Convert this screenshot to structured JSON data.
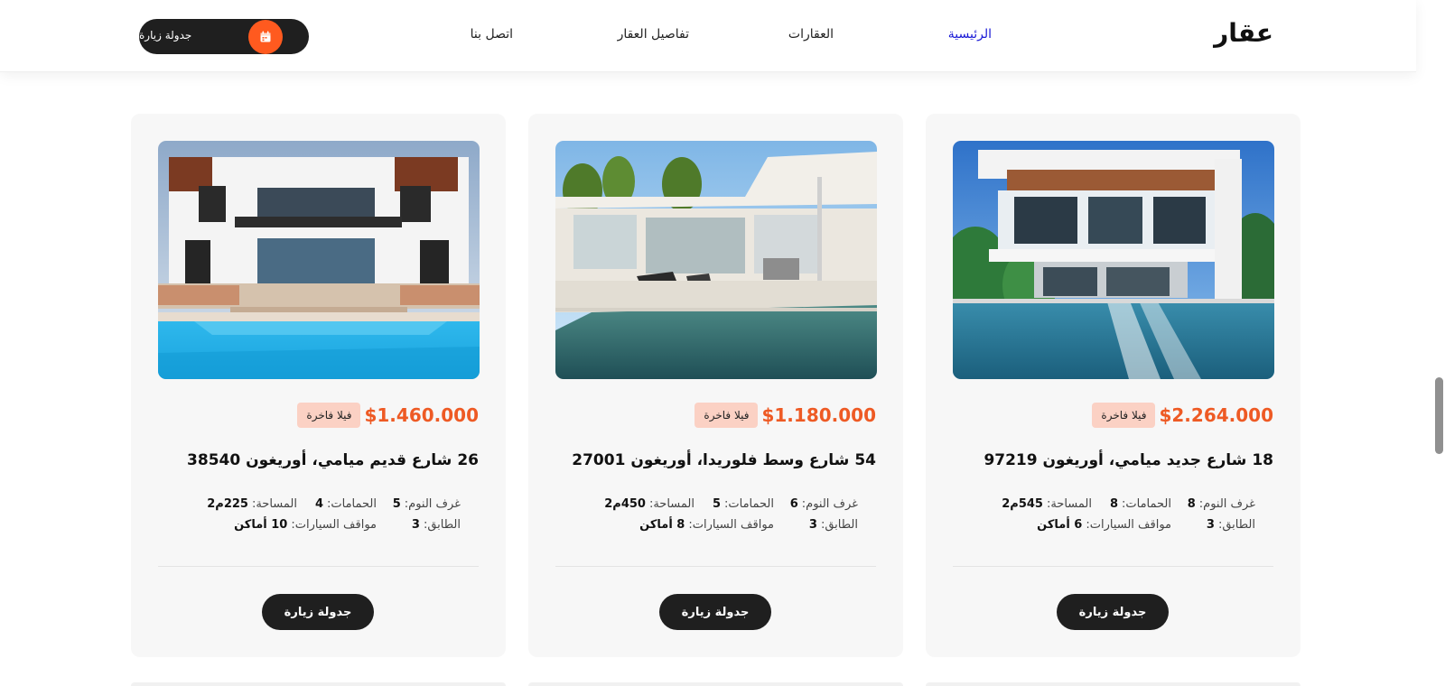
{
  "header": {
    "logo": "عقار",
    "nav": [
      "الرئيسية",
      "العقارات",
      "تفاصيل العقار",
      "اتصل بنا"
    ],
    "active_index": 0,
    "cta_label": "جدولة زيارة",
    "cta_icon": "calendar-icon"
  },
  "colors": {
    "accent": "#ee5a24",
    "active_link": "#1a1ad6",
    "dark_button": "#1f1f1f",
    "tag_background": "#fbd1c4"
  },
  "labels": {
    "bedrooms": "غرف النوم:",
    "bathrooms": "الحمامات:",
    "area": "المساحة:",
    "floor": "الطابق:",
    "parking": "مواقف السيارات:"
  },
  "properties": [
    {
      "price": "$2.264.000",
      "tag": "فيلا فاخرة",
      "address": "18 شارع جديد ميامي، أوريغون 97219",
      "bedrooms": "8",
      "bathrooms": "8",
      "area": "545م2",
      "floor": "3",
      "parking": "6 أماكن",
      "button": "جدولة زيارة"
    },
    {
      "price": "$1.180.000",
      "tag": "فيلا فاخرة",
      "address": "54 شارع وسط فلوريدا، أوريغون 27001",
      "bedrooms": "6",
      "bathrooms": "5",
      "area": "450م2",
      "floor": "3",
      "parking": "8 أماكن",
      "button": "جدولة زيارة"
    },
    {
      "price": "$1.460.000",
      "tag": "فيلا فاخرة",
      "address": "26 شارع قديم ميامي، أوريغون 38540",
      "bedrooms": "5",
      "bathrooms": "4",
      "area": "225م2",
      "floor": "3",
      "parking": "10 أماكن",
      "button": "جدولة زيارة"
    }
  ]
}
